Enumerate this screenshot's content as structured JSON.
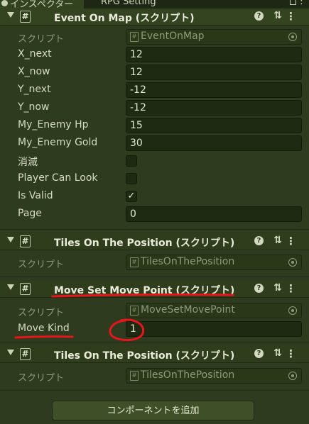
{
  "tabs": [
    {
      "label": "インスペクター",
      "icon": "info-icon",
      "active": true
    },
    {
      "label": "RPG Setting",
      "active": false
    }
  ],
  "components": [
    {
      "title": "Event On Map (スクリプト)",
      "script_label": "スクリプト",
      "script_value": "EventOnMap",
      "fields": [
        {
          "label": "X_next",
          "value": "12",
          "type": "number"
        },
        {
          "label": "X_now",
          "value": "12",
          "type": "number"
        },
        {
          "label": "Y_next",
          "value": "-12",
          "type": "number"
        },
        {
          "label": "Y_now",
          "value": "-12",
          "type": "number"
        },
        {
          "label": "My_Enemy Hp",
          "value": "15",
          "type": "number"
        },
        {
          "label": "My_Enemy Gold",
          "value": "30",
          "type": "number"
        },
        {
          "label": "消滅",
          "checked": false,
          "type": "bool"
        },
        {
          "label": "Player Can Look",
          "checked": false,
          "type": "bool"
        },
        {
          "label": "Is Valid",
          "checked": true,
          "type": "bool"
        },
        {
          "label": "Page",
          "value": "0",
          "type": "number"
        }
      ]
    },
    {
      "title": "Tiles On The Position (スクリプト)",
      "script_label": "スクリプト",
      "script_value": "TilesOnThePosition"
    },
    {
      "title": "Move Set Move Point (スクリプト)",
      "script_label": "スクリプト",
      "script_value": "MoveSetMovePoint",
      "fields": [
        {
          "label": "Move Kind",
          "value": "1",
          "type": "number"
        }
      ]
    },
    {
      "title": "Tiles On The Position (スクリプト)",
      "script_label": "スクリプト",
      "script_value": "TilesOnThePosition"
    }
  ],
  "add_component_label": "コンポーネントを追加",
  "icons": {
    "script": "csharp-script-icon",
    "help": "help-icon",
    "preset": "preset-icon",
    "menu": "kebab-menu-icon",
    "lock": "lock-icon"
  },
  "annotation_color": "#e8151b",
  "checkmark_glyph": "✓",
  "script_icon_glyph": "#",
  "help_glyph": "?",
  "preset_glyph": "⇅",
  "menu_glyph": "⋮",
  "tab_menu_glyph": "⋮"
}
